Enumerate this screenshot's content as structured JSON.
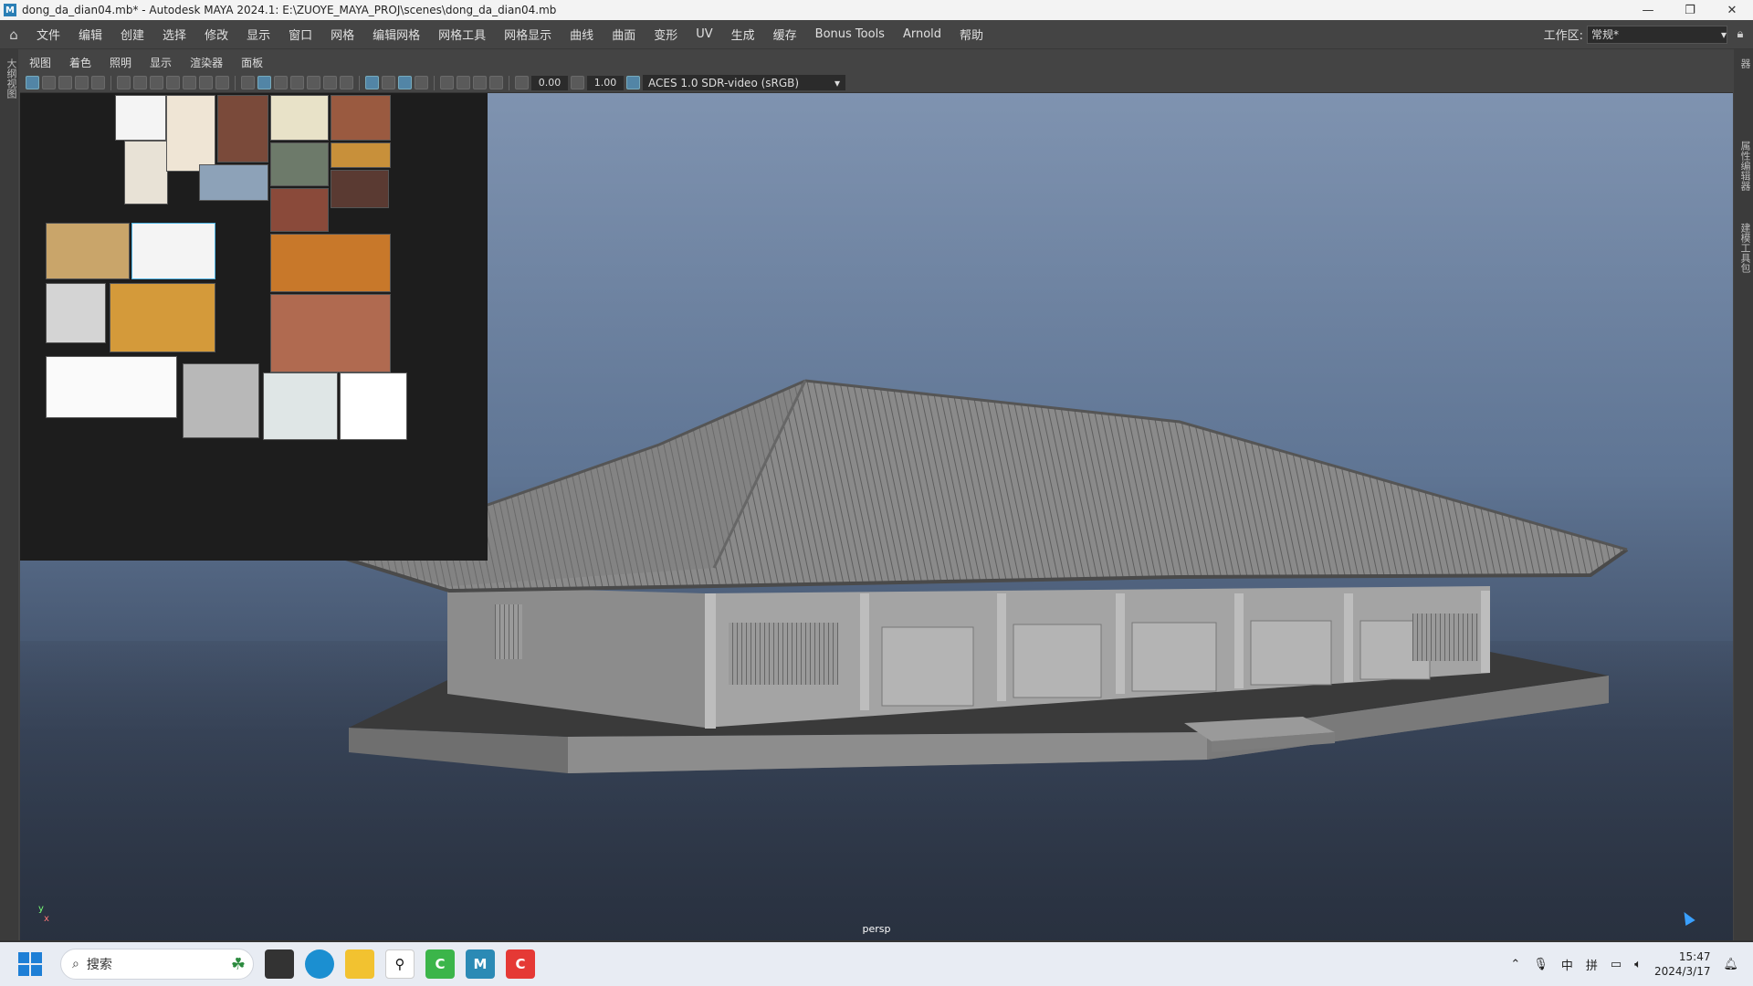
{
  "window": {
    "title": "dong_da_dian04.mb* - Autodesk MAYA 2024.1: E:\\ZUOYE_MAYA_PROJ\\scenes\\dong_da_dian04.mb",
    "app_badge": "M"
  },
  "menubar": {
    "items": [
      "文件",
      "编辑",
      "创建",
      "选择",
      "修改",
      "显示",
      "窗口",
      "网格",
      "编辑网格",
      "网格工具",
      "网格显示",
      "曲线",
      "曲面",
      "变形",
      "UV",
      "生成",
      "缓存",
      "Bonus Tools",
      "Arnold",
      "帮助"
    ],
    "workspace_label": "工作区:",
    "workspace_value": "常规*"
  },
  "side_tabs": {
    "left": "大纲视图",
    "right": [
      "通道盒/层编辑器",
      "属性编辑器",
      "建模工具包"
    ]
  },
  "panel_menu": {
    "items": [
      "视图",
      "着色",
      "照明",
      "显示",
      "渲染器",
      "面板"
    ]
  },
  "panel_toolbar": {
    "exposure": "0.00",
    "gamma": "1.00",
    "color_management": "ACES 1.0 SDR-video (sRGB)"
  },
  "viewport": {
    "camera": "persp",
    "axis_y": "y",
    "axis_x": "x"
  },
  "taskbar": {
    "search_placeholder": "搜索",
    "ime_1": "中",
    "ime_2": "拼",
    "time": "15:47",
    "date": "2024/3/17"
  },
  "colors": {
    "maya_ui": "#444444",
    "viewport_top": "#7f93b0",
    "viewport_bottom": "#2f3a4c",
    "accent": "#5285a6"
  }
}
